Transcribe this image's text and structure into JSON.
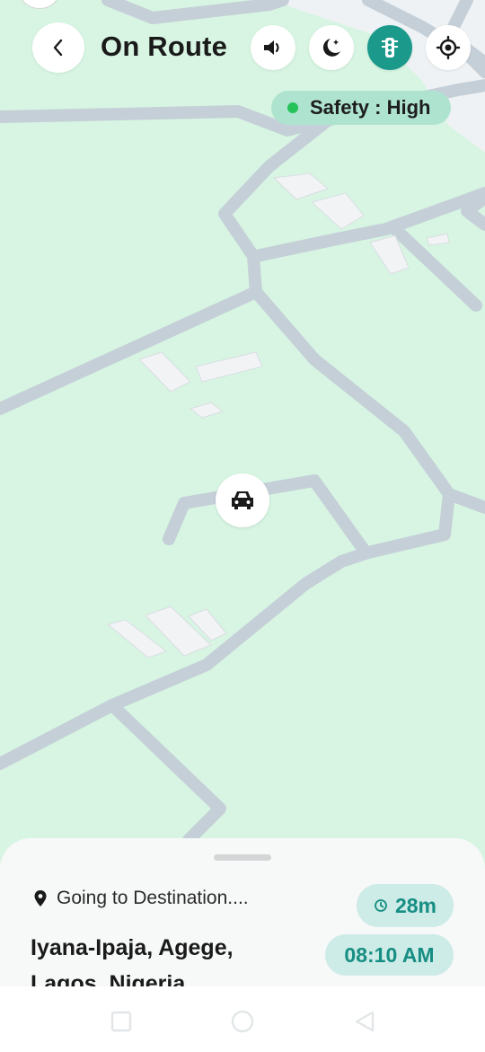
{
  "header": {
    "title": "On Route",
    "back_icon": "chevron-left-icon",
    "actions": [
      {
        "name": "sound-button",
        "icon": "speaker-icon"
      },
      {
        "name": "night-mode-button",
        "icon": "moon-star-icon"
      },
      {
        "name": "traffic-button",
        "icon": "traffic-light-icon",
        "active": true
      },
      {
        "name": "locate-button",
        "icon": "crosshair-icon"
      }
    ]
  },
  "safety": {
    "label": "Safety : High",
    "status_color": "#25c25a"
  },
  "map": {
    "background_color": "#d7f5e2",
    "road_color": "#c5cfd8",
    "marker_icon": "car-icon"
  },
  "trip": {
    "going_label": "Going to Destination....",
    "destination": "Iyana-Ipaja, Agege, Lagos, Nigeria",
    "duration": "28m",
    "eta": "08:10 AM",
    "accent_color": "#178e83"
  },
  "system_nav": {
    "icons": [
      "recents-icon",
      "home-icon",
      "back-icon"
    ]
  }
}
